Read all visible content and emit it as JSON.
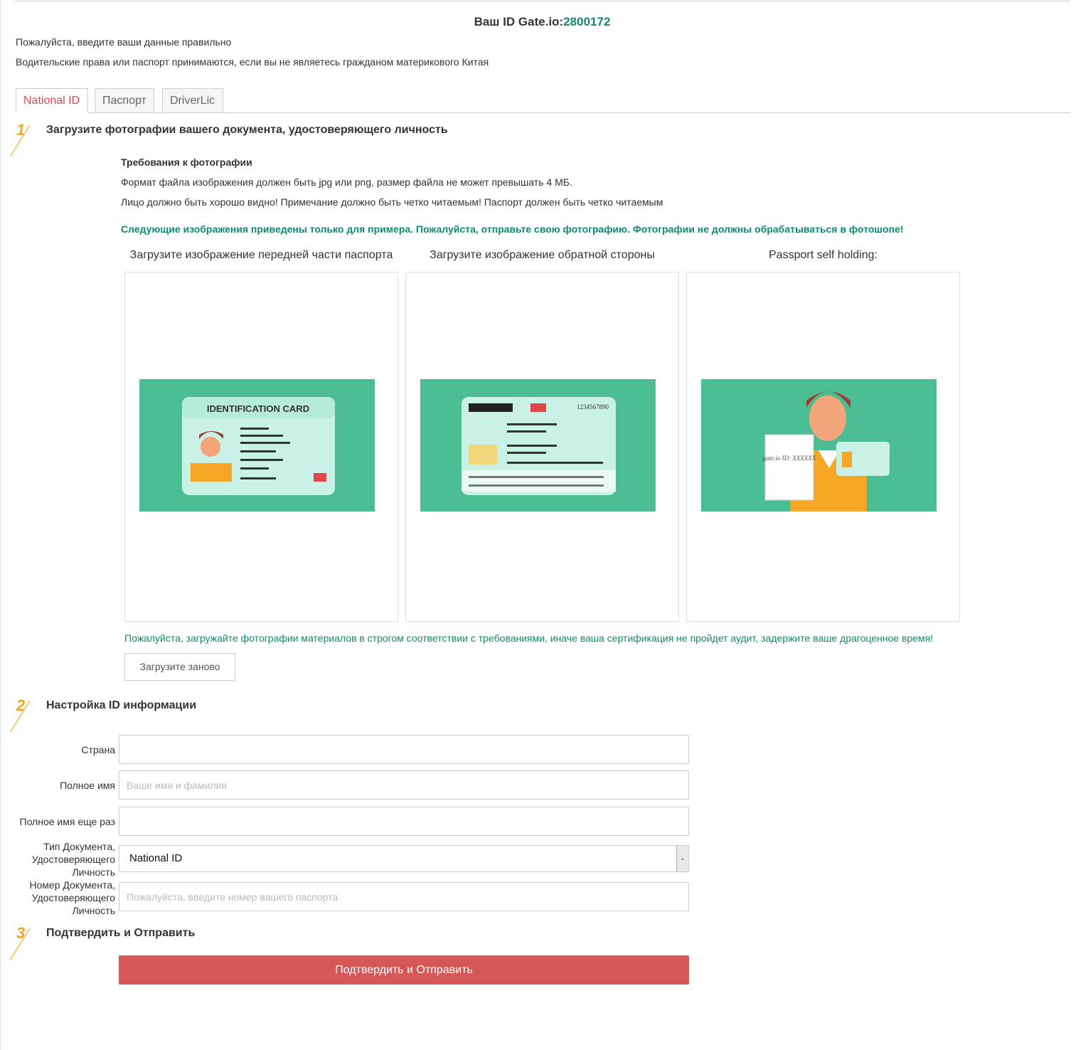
{
  "header": {
    "id_label": "Ваш ID Gate.io:",
    "id_value": "2800172"
  },
  "intro": [
    "Пожалуйста, введите ваши данные правильно",
    "Водительские права или паспорт принимаются, если вы не являетесь гражданом материкового Китая"
  ],
  "tabs": [
    {
      "label": "National ID",
      "active": true
    },
    {
      "label": "Паспорт"
    },
    {
      "label": "DriverLic"
    }
  ],
  "step1": {
    "num": "1",
    "title": "Загрузите фотографии вашего документа, удостоверяющего личность",
    "req_title": "Требования к фотографии",
    "req": [
      "Формат файла изображения должен быть jpg или png, размер файла не может превышать 4 МБ.",
      "Лицо должно быть хорошо видно! Примечание должно быть четко читаемым! Паспорт должен быть четко читаемым"
    ],
    "example_note": "Следующие изображения приведены только для примера. Пожалуйста, отправьте свою фотографию. Фотографии не должны обрабатываться в фотошопе!",
    "uploads": [
      {
        "title": "Загрузите изображение передней части паспорта",
        "card_text": "IDENTIFICATION CARD"
      },
      {
        "title": "Загрузите изображение обратной стороны",
        "card_text": "1234567890"
      },
      {
        "title": "Passport self holding:",
        "card_text": "gate.io ID: XXXXXX"
      }
    ],
    "warning": "Пожалуйста, загружайте фотографии материалов в строгом соответствии с требованиями, иначе ваша сертификация не пройдет аудит, задержите ваше драгоценное время!",
    "reupload": "Загрузите заново"
  },
  "step2": {
    "num": "2",
    "title": "Настройка ID информации",
    "country": {
      "label": "Страна",
      "value": "",
      "placeholder": ""
    },
    "fullname": {
      "label": "Полное имя",
      "value": "",
      "placeholder": "Ваше имя и фамилия"
    },
    "fullname2": {
      "label": "Полное имя еще раз",
      "value": "",
      "placeholder": ""
    },
    "doctype": {
      "label_lines": [
        "Тип Документа,",
        "Удостоверяющего",
        "Личность"
      ],
      "value": "National ID"
    },
    "docnum": {
      "label_lines": [
        "Номер Документа,",
        "Удостоверяющего",
        "Личность"
      ],
      "value": "",
      "placeholder": "Пожалуйста, введите номер вашего паспорта"
    }
  },
  "step3": {
    "num": "3",
    "title": "Подтвердить и Отправить",
    "button": "Подтвердить и Отправить"
  },
  "colors": {
    "accent": "#d55757",
    "teal": "#0f8a6e",
    "step": "#f5a623",
    "illustration": "#4cbd93"
  }
}
